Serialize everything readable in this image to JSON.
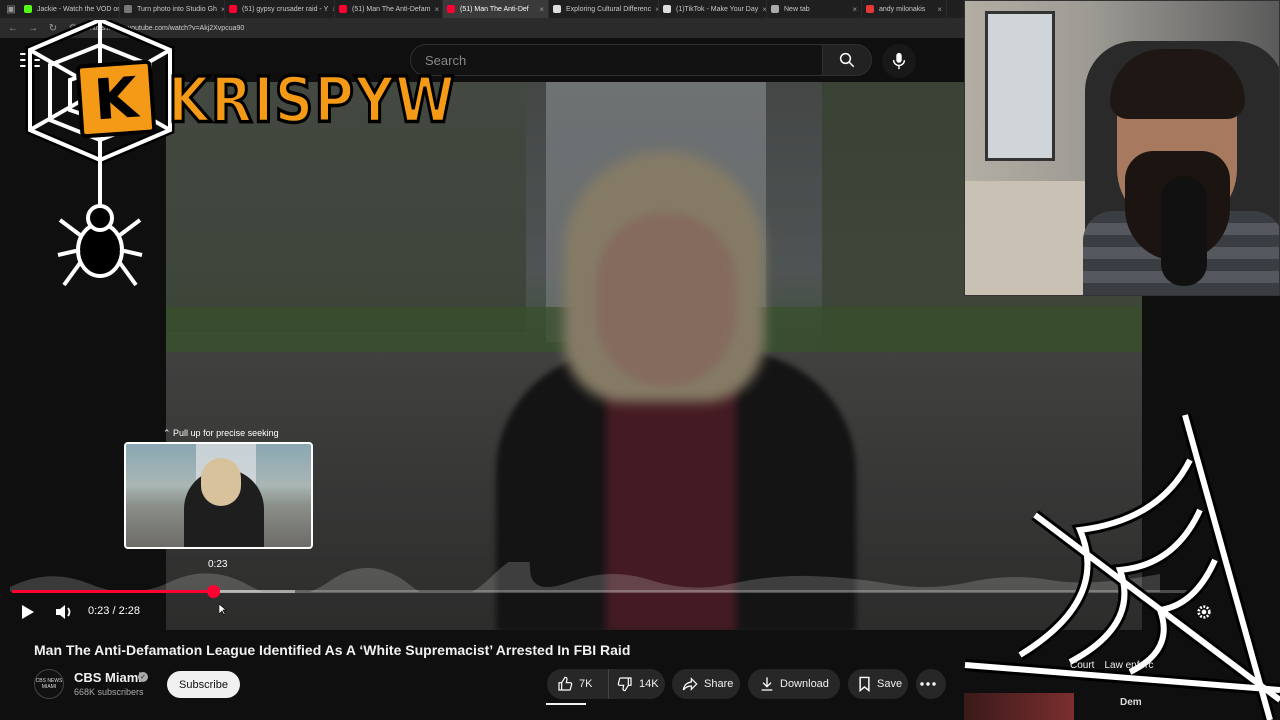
{
  "browser": {
    "tabs": [
      {
        "label": "Jackie - Watch the VOD on",
        "color": "#53fc18"
      },
      {
        "label": "Turn photo into Studio Gh",
        "color": "#777777"
      },
      {
        "label": "(51) gypsy crusader raid - Y",
        "color": "#ff0033"
      },
      {
        "label": "(51) Man The Anti-Defam",
        "color": "#ff0033"
      },
      {
        "label": "(51) Man The Anti-Def",
        "color": "#ff0033",
        "active": true
      },
      {
        "label": "Exploring Cultural Differenc",
        "color": "#dddddd"
      },
      {
        "label": "(1)TikTok - Make Your Day",
        "color": "#dddddd"
      },
      {
        "label": "New tab",
        "color": "#aaaaaa"
      },
      {
        "label": "andy milonakis",
        "color": "#e53935"
      }
    ],
    "url": "https://www.youtube.com/watch?v=Akj2Xvpcua90"
  },
  "youtube": {
    "search_placeholder": "Search",
    "seek_hint": "Pull up for precise seeking",
    "seek_preview_time": "0:23",
    "progress": {
      "played": 0.17,
      "buffered": 0.24
    },
    "time_readout": "0:23 / 2:28",
    "video_title": "Man The Anti-Defamation League Identified As A ‘White Supremacist’ Arrested In FBI Raid",
    "channel": {
      "avatar_text": "CBS NEWS MIAMI",
      "name": "CBS Miami",
      "verified_mark": "✓",
      "subscribers": "668K subscribers",
      "subscribe_label": "Subscribe"
    },
    "actions": {
      "likes": "7K",
      "dislikes": "14K",
      "share": "Share",
      "download": "Download",
      "save": "Save"
    },
    "chips": [
      "Court",
      "Law enforc"
    ],
    "recommended_title": "Dem"
  },
  "overlay": {
    "brand_text": "KRISPYW",
    "brand_letter": "K",
    "brand_color": "#f59a16"
  },
  "colors": {
    "accent": "#ff0033",
    "background": "#0f0f0f"
  }
}
